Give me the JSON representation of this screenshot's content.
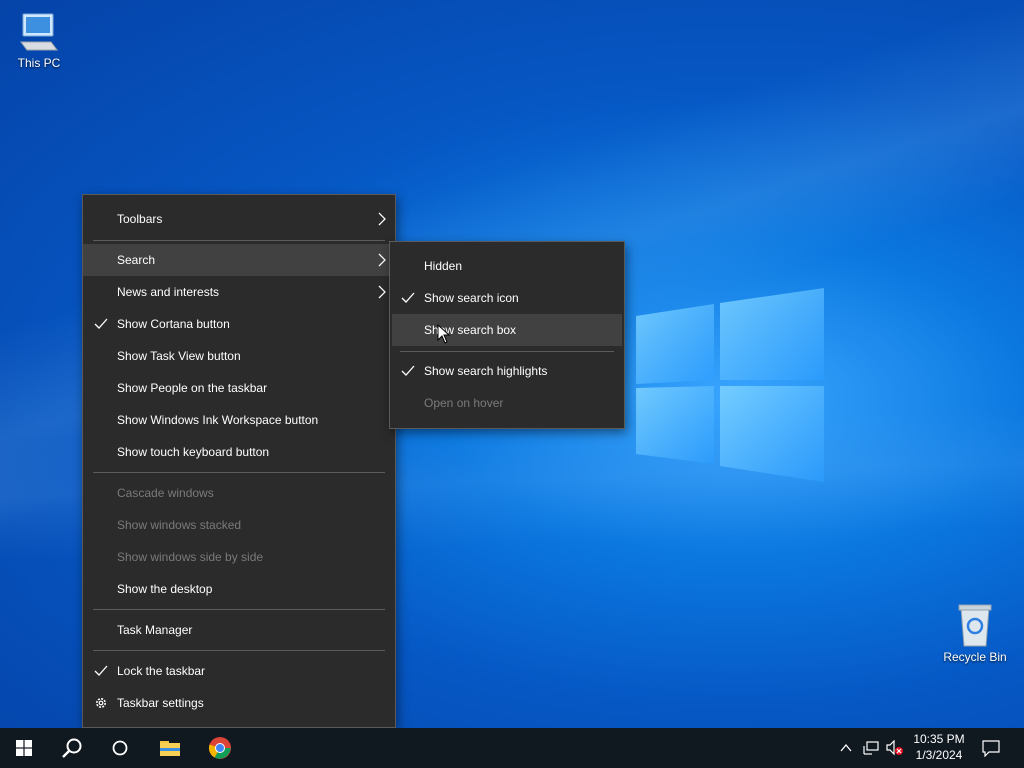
{
  "desktop": {
    "icons": [
      {
        "label": "This PC",
        "icon": "computer-icon"
      },
      {
        "label": "Recycle Bin",
        "icon": "recycle-bin-icon"
      }
    ]
  },
  "context_menu": {
    "items": [
      {
        "label": "Toolbars",
        "submenu": true
      },
      {
        "label": "Search",
        "submenu": true,
        "highlighted": true
      },
      {
        "label": "News and interests",
        "submenu": true
      },
      {
        "label": "Show Cortana button",
        "checked": true
      },
      {
        "label": "Show Task View button"
      },
      {
        "label": "Show People on the taskbar"
      },
      {
        "label": "Show Windows Ink Workspace button"
      },
      {
        "label": "Show touch keyboard button"
      },
      {
        "label": "Cascade windows",
        "disabled": true
      },
      {
        "label": "Show windows stacked",
        "disabled": true
      },
      {
        "label": "Show windows side by side",
        "disabled": true
      },
      {
        "label": "Show the desktop"
      },
      {
        "label": "Task Manager"
      },
      {
        "label": "Lock the taskbar",
        "checked": true
      },
      {
        "label": "Taskbar settings",
        "icon": "gear-icon"
      }
    ]
  },
  "search_submenu": {
    "items": [
      {
        "label": "Hidden"
      },
      {
        "label": "Show search icon",
        "checked": true
      },
      {
        "label": "Show search box",
        "highlighted": true
      },
      {
        "label": "Show search highlights",
        "checked": true
      },
      {
        "label": "Open on hover",
        "disabled": true
      }
    ]
  },
  "taskbar": {
    "buttons": [
      "windows-start-icon",
      "search-icon",
      "cortana-icon",
      "file-explorer-icon",
      "chrome-icon"
    ],
    "tray": {
      "time": "10:35 PM",
      "date": "1/3/2024",
      "icons": [
        "chevron-up-icon",
        "network-icon",
        "volume-muted-icon",
        "notification-icon"
      ]
    }
  },
  "colors": {
    "menu_bg": "#2b2b2b",
    "menu_hover": "#414141",
    "disabled_text": "#7a7a7a",
    "taskbar_bg": "#101820"
  }
}
